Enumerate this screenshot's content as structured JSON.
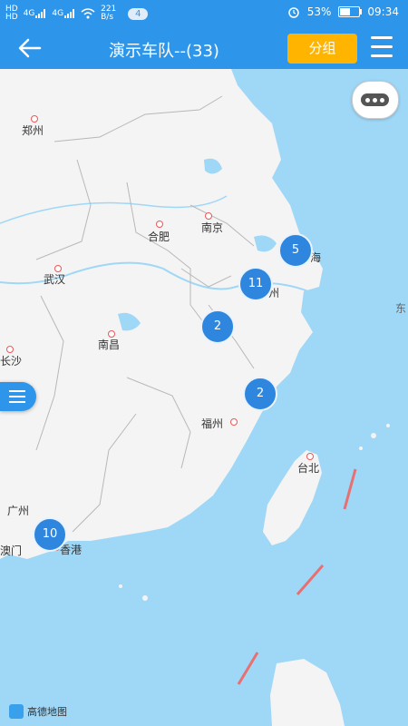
{
  "status": {
    "hd1": "HD",
    "hd2": "HD",
    "sig1": "4G",
    "sig2": "4G",
    "speed": "221 B/s",
    "badge": "4",
    "battery": "53%",
    "time": "09:34"
  },
  "header": {
    "title": "演示车队--(33)",
    "group_button": "分组"
  },
  "map": {
    "cities": [
      {
        "name": "郑州"
      },
      {
        "name": "合肥"
      },
      {
        "name": "南京"
      },
      {
        "name": "武汉"
      },
      {
        "name": "南昌"
      },
      {
        "name": "长沙"
      },
      {
        "name": "福州"
      },
      {
        "name": "台北"
      },
      {
        "name": "广州"
      },
      {
        "name": "澳门"
      },
      {
        "name": "香港"
      },
      {
        "name": "海"
      },
      {
        "name": "州"
      },
      {
        "name": "东"
      }
    ],
    "clusters": [
      {
        "count": "5"
      },
      {
        "count": "11"
      },
      {
        "count": "2"
      },
      {
        "count": "2"
      },
      {
        "count": "10"
      }
    ],
    "logo_text": "高德地图"
  },
  "colors": {
    "header": "#2e96ea",
    "group_button": "#ffb400",
    "cluster": "#2e86de",
    "sea": "#9fd7f7",
    "land": "#f4f4f4"
  }
}
